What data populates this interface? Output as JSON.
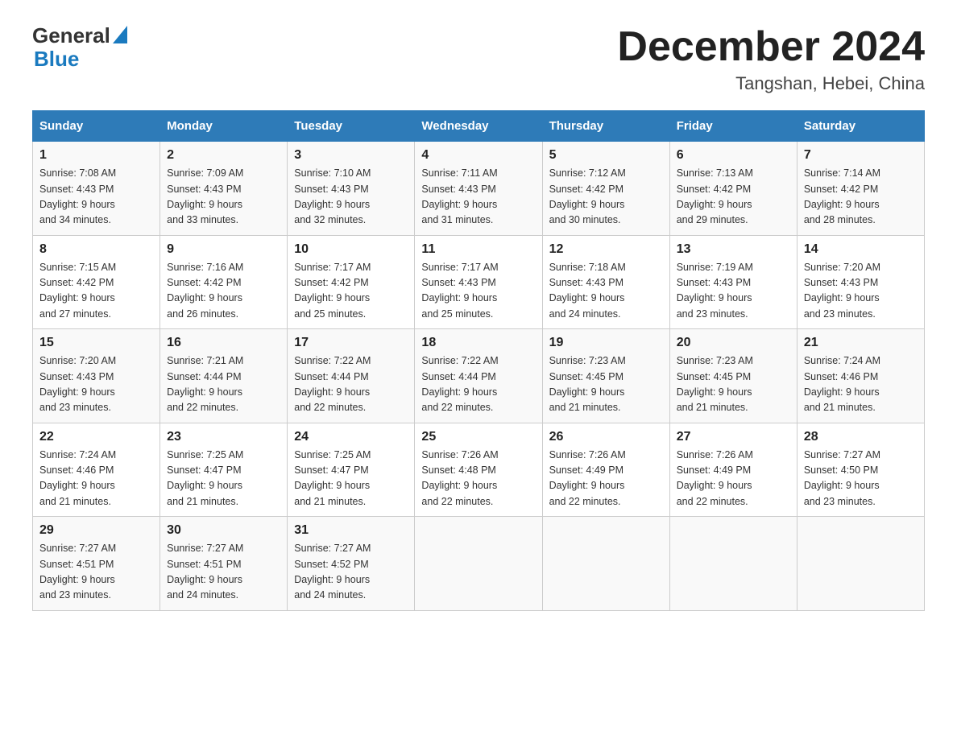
{
  "header": {
    "logo_general": "General",
    "logo_blue": "Blue",
    "month_title": "December 2024",
    "location": "Tangshan, Hebei, China"
  },
  "days_of_week": [
    "Sunday",
    "Monday",
    "Tuesday",
    "Wednesday",
    "Thursday",
    "Friday",
    "Saturday"
  ],
  "weeks": [
    [
      {
        "day": "1",
        "sunrise": "7:08 AM",
        "sunset": "4:43 PM",
        "daylight": "9 hours and 34 minutes."
      },
      {
        "day": "2",
        "sunrise": "7:09 AM",
        "sunset": "4:43 PM",
        "daylight": "9 hours and 33 minutes."
      },
      {
        "day": "3",
        "sunrise": "7:10 AM",
        "sunset": "4:43 PM",
        "daylight": "9 hours and 32 minutes."
      },
      {
        "day": "4",
        "sunrise": "7:11 AM",
        "sunset": "4:43 PM",
        "daylight": "9 hours and 31 minutes."
      },
      {
        "day": "5",
        "sunrise": "7:12 AM",
        "sunset": "4:42 PM",
        "daylight": "9 hours and 30 minutes."
      },
      {
        "day": "6",
        "sunrise": "7:13 AM",
        "sunset": "4:42 PM",
        "daylight": "9 hours and 29 minutes."
      },
      {
        "day": "7",
        "sunrise": "7:14 AM",
        "sunset": "4:42 PM",
        "daylight": "9 hours and 28 minutes."
      }
    ],
    [
      {
        "day": "8",
        "sunrise": "7:15 AM",
        "sunset": "4:42 PM",
        "daylight": "9 hours and 27 minutes."
      },
      {
        "day": "9",
        "sunrise": "7:16 AM",
        "sunset": "4:42 PM",
        "daylight": "9 hours and 26 minutes."
      },
      {
        "day": "10",
        "sunrise": "7:17 AM",
        "sunset": "4:42 PM",
        "daylight": "9 hours and 25 minutes."
      },
      {
        "day": "11",
        "sunrise": "7:17 AM",
        "sunset": "4:43 PM",
        "daylight": "9 hours and 25 minutes."
      },
      {
        "day": "12",
        "sunrise": "7:18 AM",
        "sunset": "4:43 PM",
        "daylight": "9 hours and 24 minutes."
      },
      {
        "day": "13",
        "sunrise": "7:19 AM",
        "sunset": "4:43 PM",
        "daylight": "9 hours and 23 minutes."
      },
      {
        "day": "14",
        "sunrise": "7:20 AM",
        "sunset": "4:43 PM",
        "daylight": "9 hours and 23 minutes."
      }
    ],
    [
      {
        "day": "15",
        "sunrise": "7:20 AM",
        "sunset": "4:43 PM",
        "daylight": "9 hours and 23 minutes."
      },
      {
        "day": "16",
        "sunrise": "7:21 AM",
        "sunset": "4:44 PM",
        "daylight": "9 hours and 22 minutes."
      },
      {
        "day": "17",
        "sunrise": "7:22 AM",
        "sunset": "4:44 PM",
        "daylight": "9 hours and 22 minutes."
      },
      {
        "day": "18",
        "sunrise": "7:22 AM",
        "sunset": "4:44 PM",
        "daylight": "9 hours and 22 minutes."
      },
      {
        "day": "19",
        "sunrise": "7:23 AM",
        "sunset": "4:45 PM",
        "daylight": "9 hours and 21 minutes."
      },
      {
        "day": "20",
        "sunrise": "7:23 AM",
        "sunset": "4:45 PM",
        "daylight": "9 hours and 21 minutes."
      },
      {
        "day": "21",
        "sunrise": "7:24 AM",
        "sunset": "4:46 PM",
        "daylight": "9 hours and 21 minutes."
      }
    ],
    [
      {
        "day": "22",
        "sunrise": "7:24 AM",
        "sunset": "4:46 PM",
        "daylight": "9 hours and 21 minutes."
      },
      {
        "day": "23",
        "sunrise": "7:25 AM",
        "sunset": "4:47 PM",
        "daylight": "9 hours and 21 minutes."
      },
      {
        "day": "24",
        "sunrise": "7:25 AM",
        "sunset": "4:47 PM",
        "daylight": "9 hours and 21 minutes."
      },
      {
        "day": "25",
        "sunrise": "7:26 AM",
        "sunset": "4:48 PM",
        "daylight": "9 hours and 22 minutes."
      },
      {
        "day": "26",
        "sunrise": "7:26 AM",
        "sunset": "4:49 PM",
        "daylight": "9 hours and 22 minutes."
      },
      {
        "day": "27",
        "sunrise": "7:26 AM",
        "sunset": "4:49 PM",
        "daylight": "9 hours and 22 minutes."
      },
      {
        "day": "28",
        "sunrise": "7:27 AM",
        "sunset": "4:50 PM",
        "daylight": "9 hours and 23 minutes."
      }
    ],
    [
      {
        "day": "29",
        "sunrise": "7:27 AM",
        "sunset": "4:51 PM",
        "daylight": "9 hours and 23 minutes."
      },
      {
        "day": "30",
        "sunrise": "7:27 AM",
        "sunset": "4:51 PM",
        "daylight": "9 hours and 24 minutes."
      },
      {
        "day": "31",
        "sunrise": "7:27 AM",
        "sunset": "4:52 PM",
        "daylight": "9 hours and 24 minutes."
      },
      null,
      null,
      null,
      null
    ]
  ],
  "labels": {
    "sunrise": "Sunrise:",
    "sunset": "Sunset:",
    "daylight": "Daylight:"
  }
}
